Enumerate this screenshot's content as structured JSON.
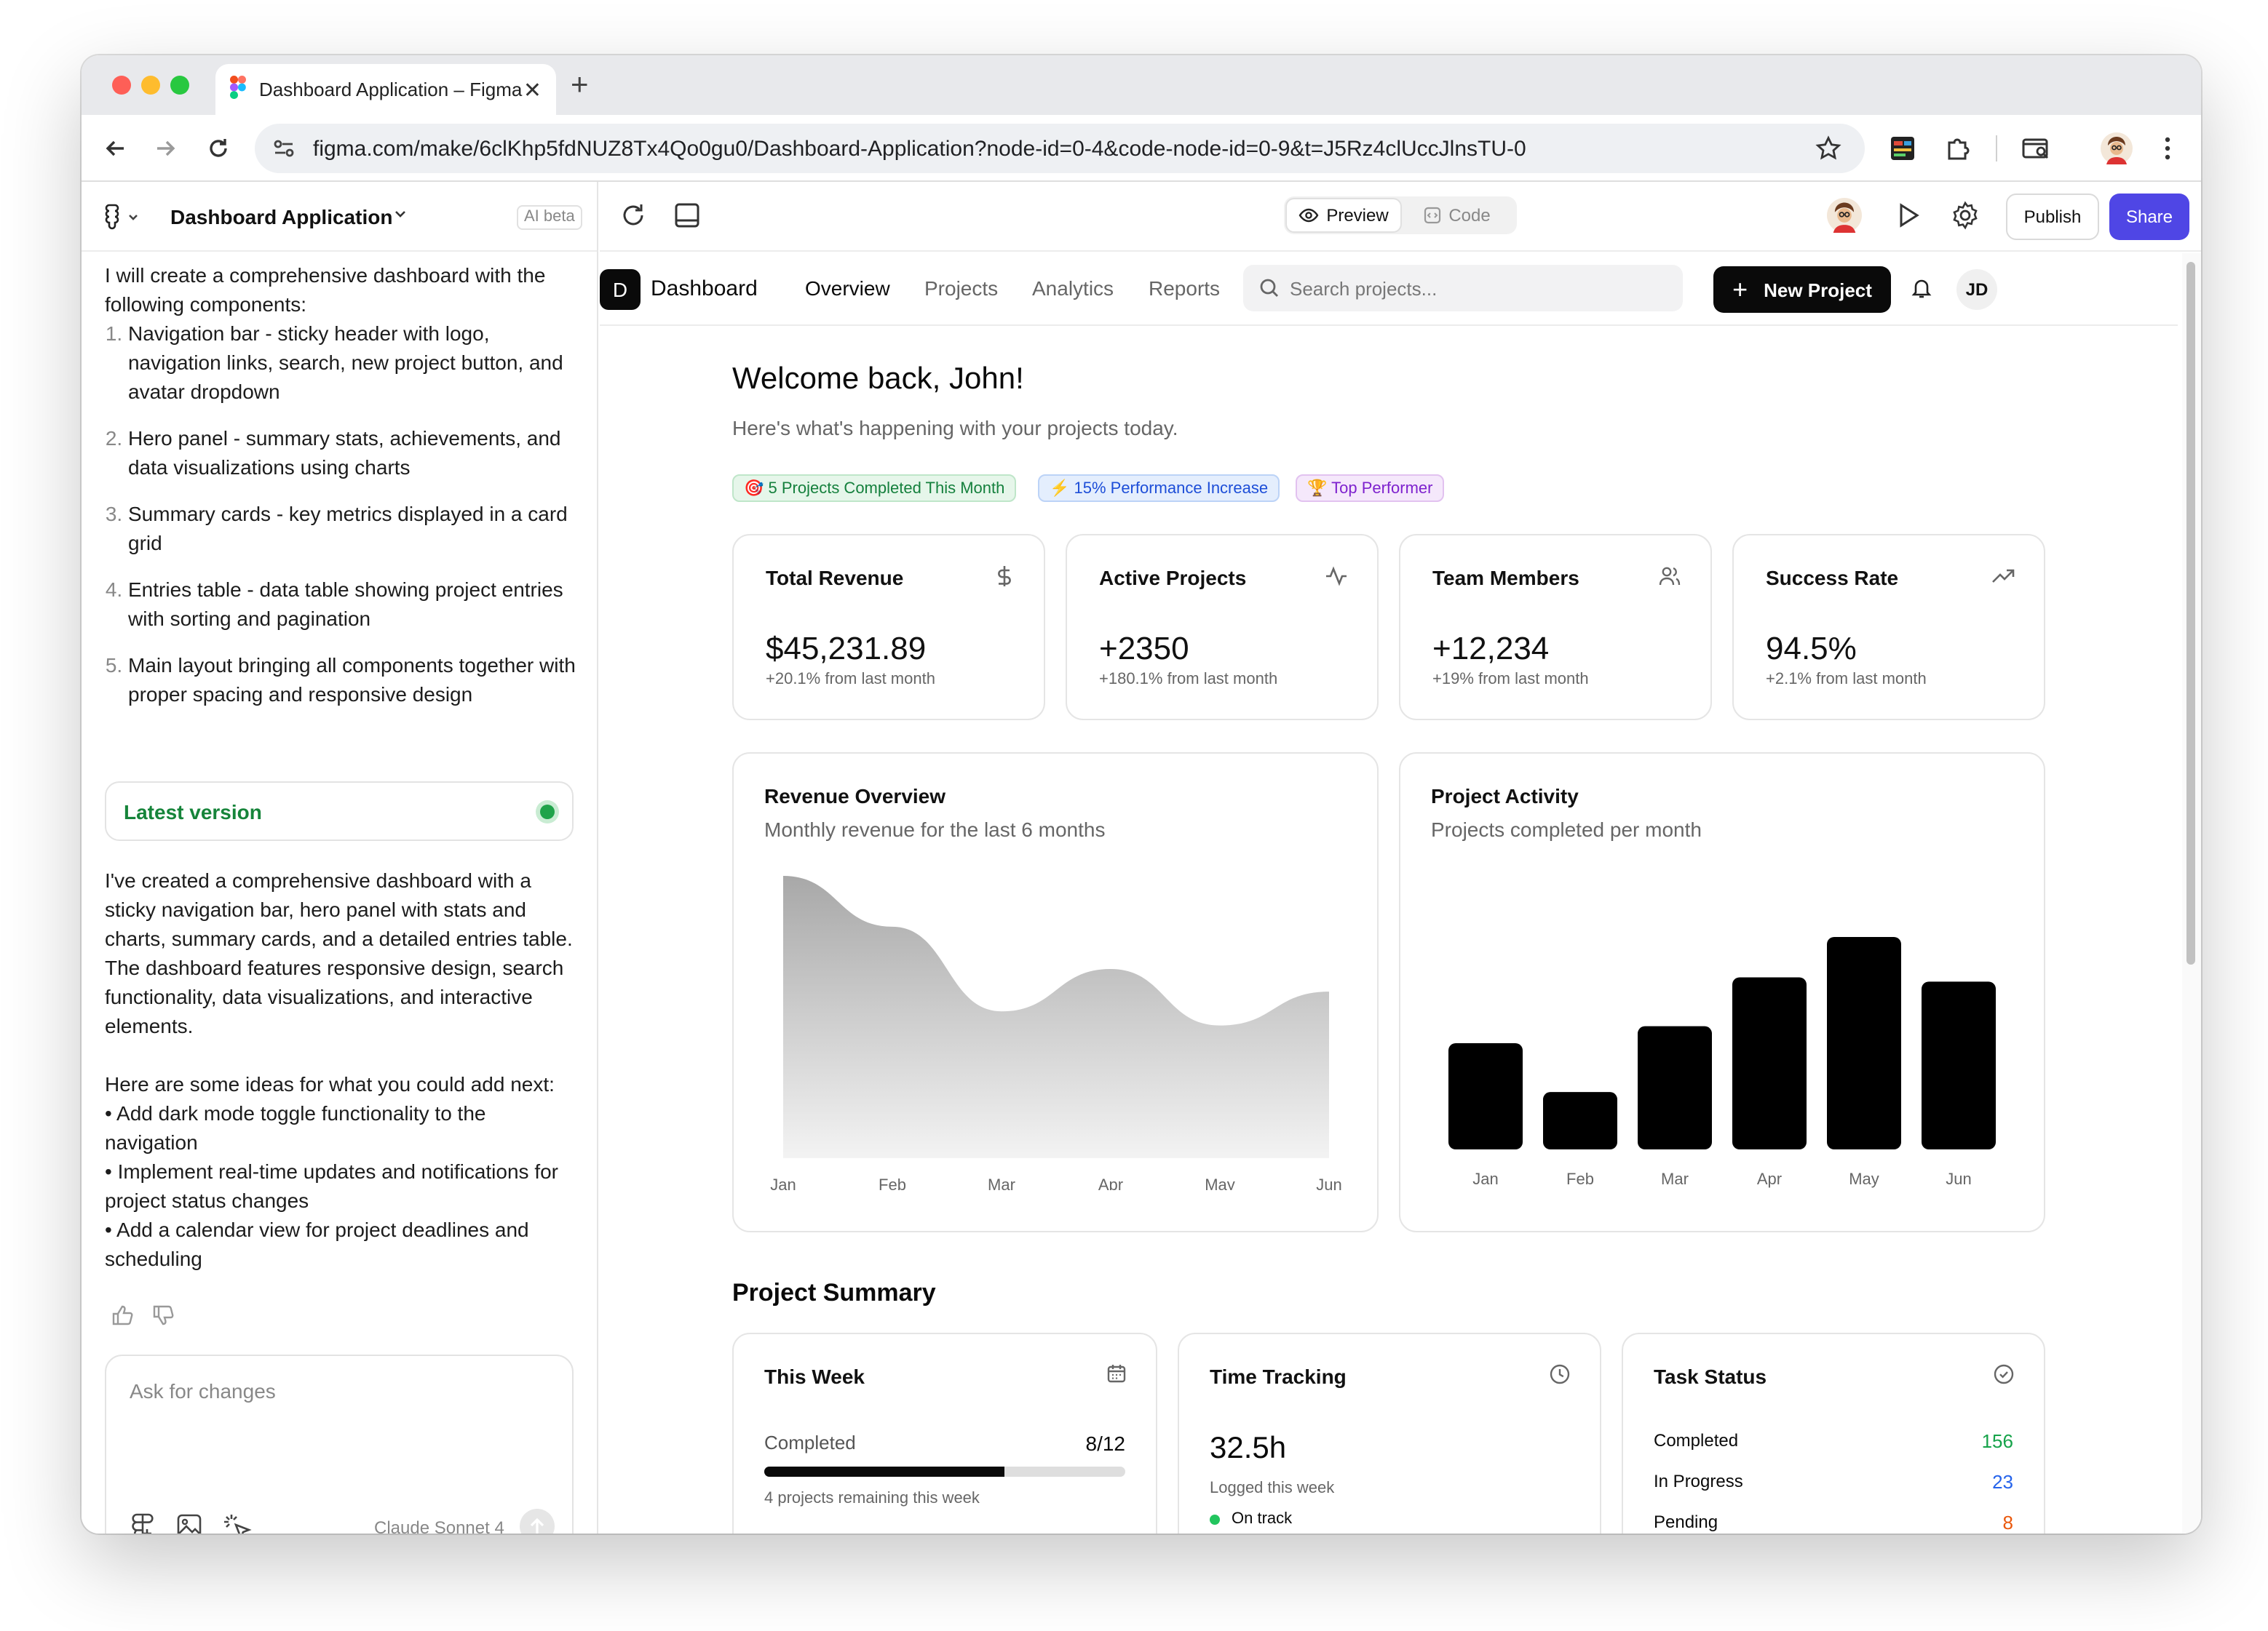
{
  "browser": {
    "tab_title": "Dashboard Application – Figma",
    "url": "figma.com/make/6clKhp5fdNUZ8Tx4Qo0gu0/Dashboard-Application?node-id=0-4&code-node-id=0-9&t=J5Rz4clUccJlnsTU-0"
  },
  "editor": {
    "project_title": "Dashboard Application",
    "ai_badge": "AI beta",
    "view_tabs": {
      "preview": "Preview",
      "code": "Code"
    },
    "publish_label": "Publish",
    "share_label": "Share"
  },
  "chat": {
    "intro": "I will create a comprehensive dashboard with the following components:",
    "steps": [
      "Navigation bar - sticky header with logo, navigation links, search, new project button, and avatar dropdown",
      "Hero panel - summary stats, achievements, and data visualizations using charts",
      "Summary cards - key metrics displayed in a card grid",
      "Entries table - data table showing project entries with sorting and pagination",
      "Main layout bringing all components together with proper spacing and responsive design"
    ],
    "version_label": "Latest version",
    "response": "I've created a comprehensive dashboard with a sticky navigation bar, hero panel with stats and charts, summary cards, and a detailed entries table. The dashboard features responsive design, search functionality, data visualizations, and interactive elements.",
    "ideas_intro": "Here are some ideas for what you could add next:",
    "ideas": [
      "• Add dark mode toggle functionality to the navigation",
      "• Implement real-time updates and notifications for project status changes",
      "• Add a calendar view for project deadlines and scheduling"
    ],
    "input_placeholder": "Ask for changes",
    "model": "Claude Sonnet 4"
  },
  "dashboard": {
    "logo_letter": "D",
    "brand": "Dashboard",
    "nav_links": [
      "Overview",
      "Projects",
      "Analytics",
      "Reports"
    ],
    "search_placeholder": "Search projects...",
    "new_project_label": "New Project",
    "avatar_initials": "JD",
    "welcome": "Welcome back, John!",
    "subtitle": "Here's what's happening with your projects today.",
    "badges": [
      "🎯 5 Projects Completed This Month",
      "⚡ 15% Performance Increase",
      "🏆 Top Performer"
    ],
    "badge_colors": [
      "#e6f6ea",
      "#e4eefd",
      "#f5e8fb"
    ],
    "stats": [
      {
        "title": "Total Revenue",
        "value": "$45,231.89",
        "sub": "+20.1% from last month",
        "icon": "dollar-icon"
      },
      {
        "title": "Active Projects",
        "value": "+2350",
        "sub": "+180.1% from last month",
        "icon": "activity-icon"
      },
      {
        "title": "Team Members",
        "value": "+12,234",
        "sub": "+19% from last month",
        "icon": "users-icon"
      },
      {
        "title": "Success Rate",
        "value": "94.5%",
        "sub": "+2.1% from last month",
        "icon": "trending-up-icon"
      }
    ],
    "revenue_card": {
      "title": "Revenue Overview",
      "subtitle": "Monthly revenue for the last 6 months"
    },
    "activity_card": {
      "title": "Project Activity",
      "subtitle": "Projects completed per month"
    },
    "summary_title": "Project Summary",
    "this_week": {
      "title": "This Week",
      "label": "Completed",
      "value": "8/12",
      "progress": 0.667,
      "note": "4 projects remaining this week"
    },
    "time_tracking": {
      "title": "Time Tracking",
      "value": "32.5h",
      "label": "Logged this week",
      "status": "On track"
    },
    "task_status": {
      "title": "Task Status",
      "rows": [
        {
          "label": "Completed",
          "value": "156",
          "color": "#16a34a"
        },
        {
          "label": "In Progress",
          "value": "23",
          "color": "#2563eb"
        },
        {
          "label": "Pending",
          "value": "8",
          "color": "#ea580c"
        }
      ]
    },
    "help": "?"
  },
  "chart_data": [
    {
      "type": "area",
      "title": "Revenue Overview",
      "subtitle": "Monthly revenue for the last 6 months",
      "categories": [
        "Jan",
        "Feb",
        "Mar",
        "Apr",
        "May",
        "Jun"
      ],
      "values": [
        100,
        82,
        52,
        67,
        47,
        59
      ],
      "ylim": [
        0,
        100
      ],
      "grid": false,
      "legend": "none"
    },
    {
      "type": "bar",
      "title": "Project Activity",
      "subtitle": "Projects completed per month",
      "categories": [
        "Jan",
        "Feb",
        "Mar",
        "Apr",
        "May",
        "Jun"
      ],
      "values": [
        50,
        27,
        58,
        81,
        100,
        79
      ],
      "ylim": [
        0,
        100
      ],
      "grid": false,
      "legend": "none"
    }
  ]
}
